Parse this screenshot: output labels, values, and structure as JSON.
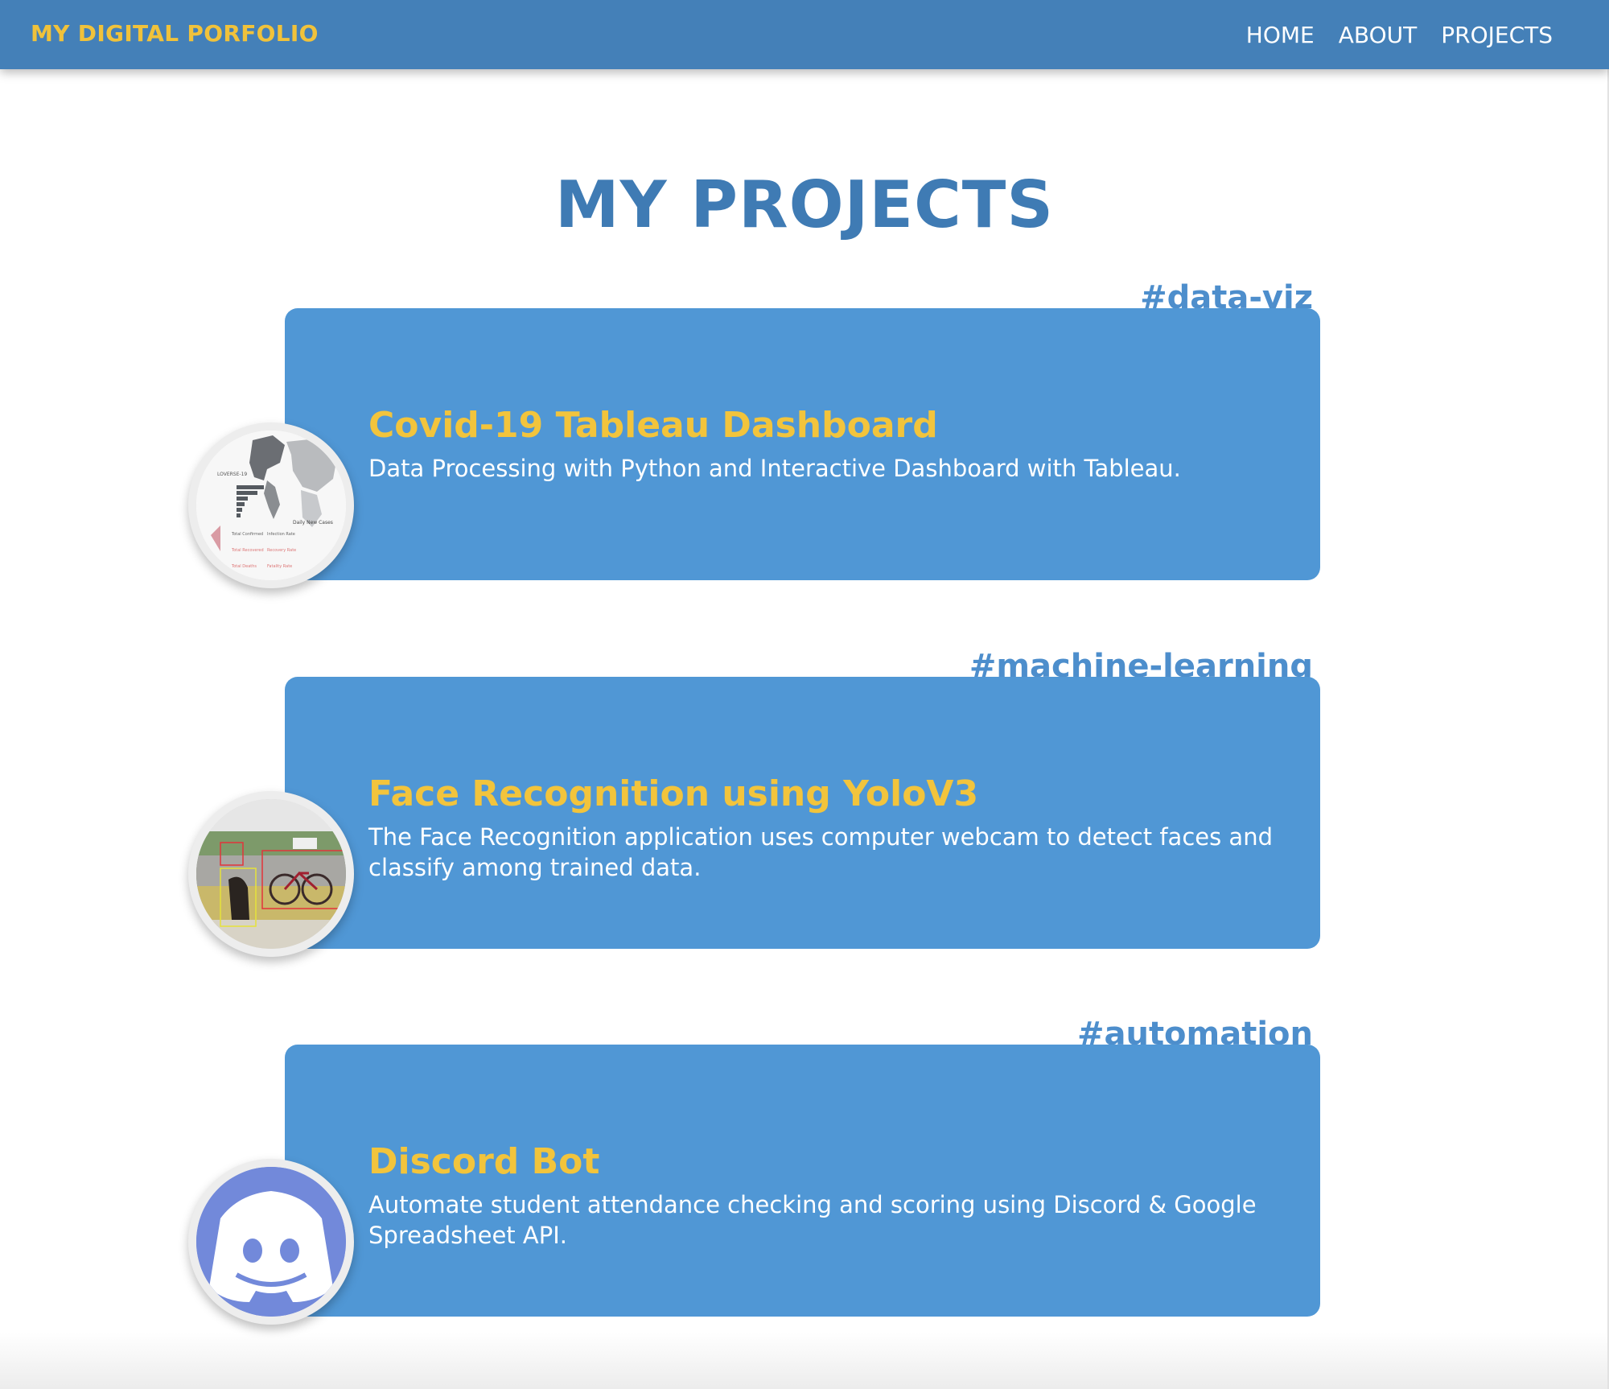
{
  "navbar": {
    "brand": "MY DIGITAL PORFOLIO",
    "links": [
      "HOME",
      "ABOUT",
      "PROJECTS"
    ]
  },
  "main": {
    "title": "MY PROJECTS",
    "projects": [
      {
        "tag": "#data-viz",
        "title": "Covid-19 Tableau Dashboard",
        "description": "Data Processing with Python and Interactive Dashboard with Tableau.",
        "thumbnail_icon": "map-dashboard-thumbnail"
      },
      {
        "tag": "#machine-learning",
        "title": "Face Recognition using YoloV3",
        "description": "The Face Recognition application uses computer webcam to detect faces and classify among trained data.",
        "thumbnail_icon": "object-detection-thumbnail"
      },
      {
        "tag": "#automation",
        "title": "Discord Bot",
        "description": "Automate student attendance checking and scoring using Discord & Google Spreadsheet API.",
        "thumbnail_icon": "discord-logo"
      }
    ]
  },
  "colors": {
    "navbar_bg": "#4480b8",
    "brand": "#f0c23b",
    "title": "#3f7bb4",
    "card_bg": "#5097d5",
    "card_title": "#f2c43c",
    "tag": "#4d8ecc",
    "discord": "#7289da"
  }
}
